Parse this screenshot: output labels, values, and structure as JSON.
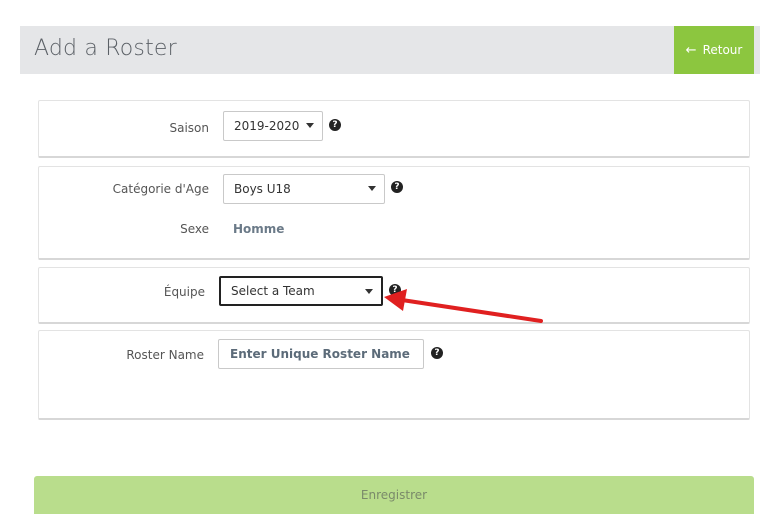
{
  "header": {
    "title": "Add a Roster",
    "back_label": "Retour",
    "accent_color": "#8cc63f"
  },
  "form": {
    "season": {
      "label": "Saison",
      "value": "2019-2020"
    },
    "age_category": {
      "label": "Catégorie d'Age",
      "value": "Boys U18"
    },
    "sex": {
      "label": "Sexe",
      "value": "Homme"
    },
    "team": {
      "label": "Équipe",
      "value": "Select a Team"
    },
    "roster_name": {
      "label": "Roster Name",
      "placeholder": "Enter Unique Roster Name"
    }
  },
  "footer": {
    "save_label": "Enregistrer"
  },
  "annotation": {
    "arrow_color": "#e02020",
    "icon": "red-arrow-icon"
  },
  "icons": {
    "help": "question-circle-icon",
    "back": "arrow-left-icon",
    "caret": "caret-down-icon"
  }
}
